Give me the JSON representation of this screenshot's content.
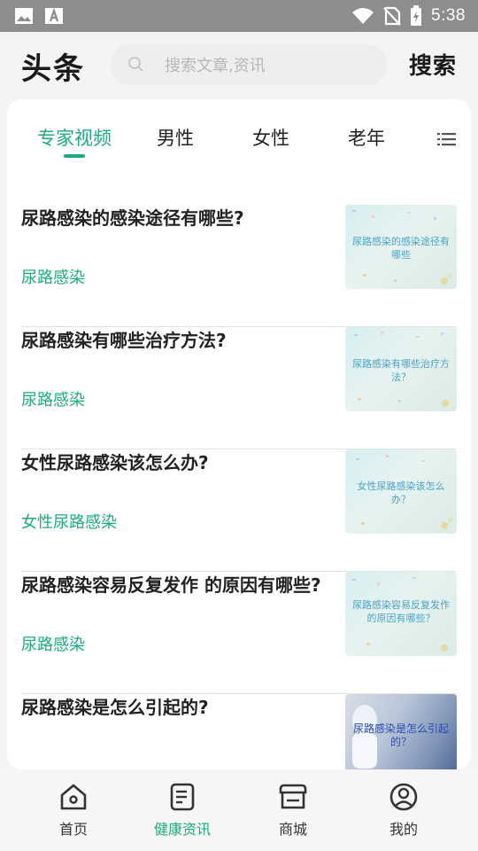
{
  "status_bar": {
    "time": "5:38",
    "icons": [
      "image-icon",
      "a-text-icon",
      "wifi-icon",
      "no-sim-icon",
      "battery-charging-icon"
    ]
  },
  "header": {
    "title": "头条",
    "search_placeholder": "搜索文章,资讯",
    "search_button": "搜索"
  },
  "tabs": {
    "items": [
      {
        "label": "专家视频",
        "active": true
      },
      {
        "label": "男性",
        "active": false
      },
      {
        "label": "女性",
        "active": false
      },
      {
        "label": "老年",
        "active": false
      }
    ],
    "menu_icon": "list-menu-icon"
  },
  "articles": [
    {
      "title": "尿路感染的感染途径有哪些?",
      "tag": "尿路感染",
      "thumb_caption": "尿路感染的感染途径有哪些"
    },
    {
      "title": "尿路感染有哪些治疗方法?",
      "tag": "尿路感染",
      "thumb_caption": "尿路感染有哪些治疗方法？"
    },
    {
      "title": "女性尿路感染该怎么办?",
      "tag": "女性尿路感染",
      "thumb_caption": "女性尿路感染该怎么办？"
    },
    {
      "title": "尿路感染容易反复发作 的原因有哪些?",
      "tag": "尿路感染",
      "thumb_caption": "尿路感染容易反复发作的原因有哪些？"
    },
    {
      "title": "尿路感染是怎么引起的?",
      "tag": "",
      "thumb_caption": "尿路感染是怎么引起的？"
    }
  ],
  "bottom_nav": [
    {
      "label": "首页",
      "icon": "home-icon",
      "active": false
    },
    {
      "label": "健康资讯",
      "icon": "news-document-icon",
      "active": true
    },
    {
      "label": "商城",
      "icon": "store-icon",
      "active": false
    },
    {
      "label": "我的",
      "icon": "user-profile-icon",
      "active": false
    }
  ],
  "colors": {
    "accent": "#1aae7a",
    "status_bar": "#8d8d8d",
    "background": "#f3f4f5"
  }
}
